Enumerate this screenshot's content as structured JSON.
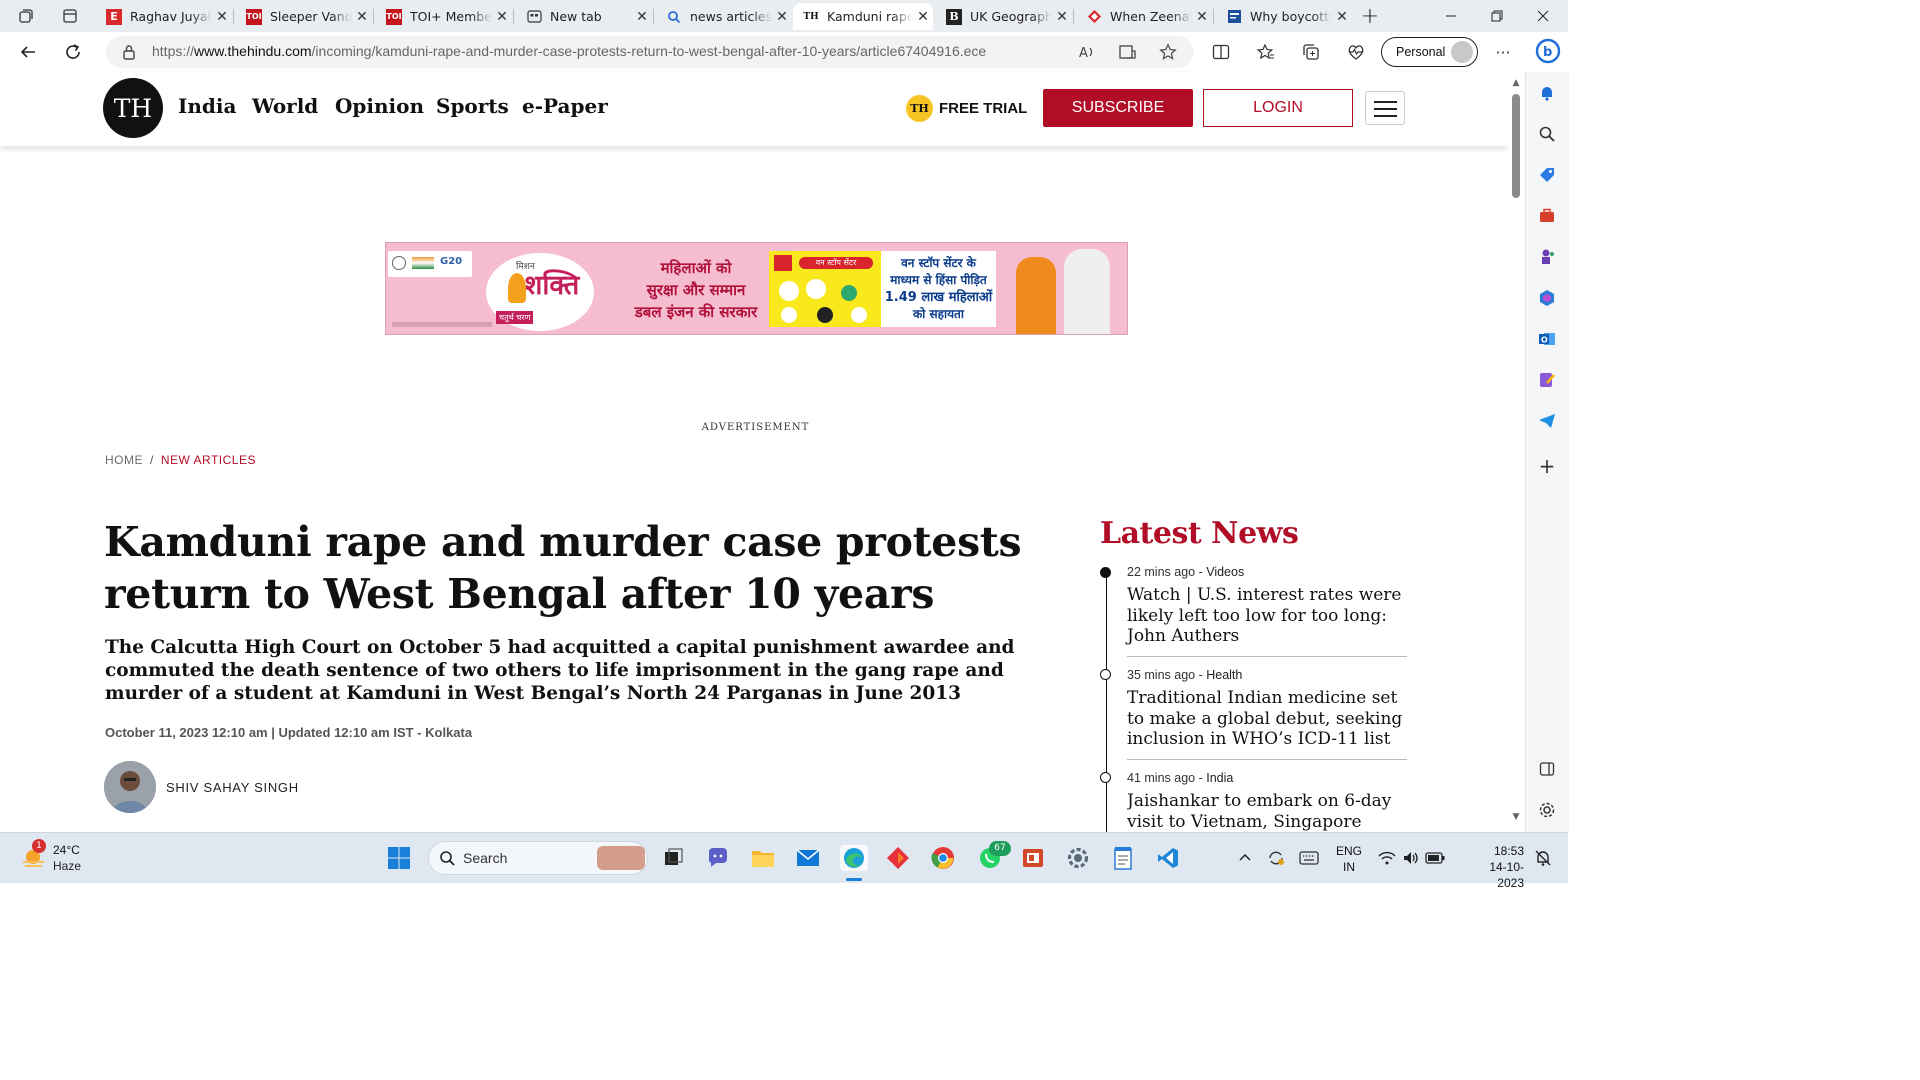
{
  "browser": {
    "tabs": [
      {
        "title": "Raghav Juyal",
        "favicon": "E"
      },
      {
        "title": "Sleeper Vande",
        "favicon": "TOI"
      },
      {
        "title": "TOI+ Membe",
        "favicon": "TOI"
      },
      {
        "title": "New tab",
        "favicon": "newtab-icon"
      },
      {
        "title": "news articles",
        "favicon": "search-icon"
      },
      {
        "title": "Kamduni rape",
        "favicon": "TH"
      },
      {
        "title": "UK Geograph",
        "favicon": "B"
      },
      {
        "title": "When Zeenat",
        "favicon": "diamond-icon"
      },
      {
        "title": "Why boycotts",
        "favicon": "news-icon"
      }
    ],
    "url_prefix": "https://",
    "url_domain": "www.thehindu.com",
    "url_path": "/incoming/kamduni-rape-and-murder-case-protests-return-to-west-bengal-after-10-years/article67404916.ece",
    "profile_label": "Personal"
  },
  "site": {
    "logo": "TH",
    "nav": [
      "India",
      "World",
      "Opinion",
      "Sports",
      "e-Paper"
    ],
    "free_trial_badge": "TH",
    "free_trial_label": "FREE TRIAL",
    "subscribe_label": "SUBSCRIBE",
    "login_label": "LOGIN"
  },
  "ad": {
    "label": "ADVERTISEMENT",
    "logo_text": "G20",
    "brand_small": "मिशन",
    "brand": "शक्ति",
    "brand_sub": "चतुर्थ चरण",
    "line1": "महिलाओं को",
    "line2": "सुरक्षा और सम्मान",
    "line3": "डबल इंजन की सरकार",
    "center_title": "वन स्टॉप सेंटर",
    "right_line1": "वन स्टॉप सेंटर के",
    "right_line2": "माध्यम से हिंसा पीड़ित",
    "right_line3": "1.49 लाख महिलाओं",
    "right_line4": "को सहायता"
  },
  "breadcrumb": {
    "home": "HOME",
    "separator": "/",
    "current": "NEW ARTICLES"
  },
  "article": {
    "headline": "Kamduni rape and murder case protests return to West Bengal after 10 years",
    "subhead": "The Calcutta High Court on October 5 had acquitted a capital punishment awardee and commuted the death sentence of two others to life imprisonment in the gang rape and murder of a student at Kamduni in West Bengal’s North 24 Parganas in June 2013",
    "dateline": "October 11, 2023 12:10 am | Updated 12:10 am IST - Kolkata",
    "author": "SHIV SAHAY SINGH"
  },
  "latest_news": {
    "title": "Latest News",
    "items": [
      {
        "time": "22 mins ago",
        "category": "Videos",
        "headline": "Watch | U.S. interest rates were likely left too low for too long: John Authers"
      },
      {
        "time": "35 mins ago",
        "category": "Health",
        "headline": "Traditional Indian medicine set to make a global debut, seeking inclusion in WHO’s ICD-11 list"
      },
      {
        "time": "41 mins ago",
        "category": "India",
        "headline": "Jaishankar to embark on 6-day visit to Vietnam, Singapore"
      }
    ]
  },
  "taskbar": {
    "weather_temp": "24°C",
    "weather_cond": "Haze",
    "weather_badge": "1",
    "search_label": "Search",
    "whatsapp_badge": "67",
    "lang_line1": "ENG",
    "lang_line2": "IN",
    "time": "18:53",
    "date": "14-10-2023"
  },
  "colors": {
    "brand_red": "#b10d26",
    "free_trial_yellow": "#f7c523",
    "ad_pink": "#f6bdd0"
  }
}
